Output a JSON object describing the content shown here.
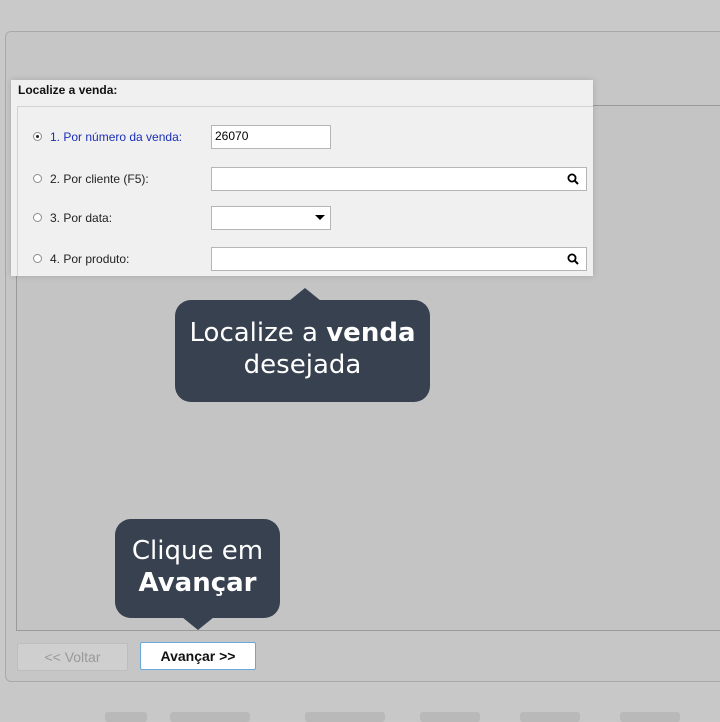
{
  "dialog": {
    "title": "Localize a venda:",
    "options": [
      {
        "label": "1. Por número da venda:",
        "selected": true,
        "input_value": "26070",
        "input_type": "text"
      },
      {
        "label": "2. Por cliente (F5):",
        "selected": false,
        "input_value": "",
        "input_type": "search",
        "icon": "search-icon"
      },
      {
        "label": "3. Por data:",
        "selected": false,
        "input_value": "",
        "input_type": "dropdown",
        "icon": "chevron-down-icon"
      },
      {
        "label": "4. Por produto:",
        "selected": false,
        "input_value": "",
        "input_type": "search",
        "icon": "search-icon"
      }
    ]
  },
  "callouts": {
    "find_sale": {
      "line1_pre": "Localize a ",
      "line1_bold": "venda",
      "line2": "desejada"
    },
    "click_next": {
      "line1": "Clique em",
      "line2_bold": "Avançar"
    }
  },
  "footer": {
    "back_label": "<< Voltar",
    "next_label": "Avançar >>"
  },
  "colors": {
    "callout_bg": "#37414f",
    "active_label": "#1a2fb5",
    "next_border": "#6aa8d8"
  }
}
